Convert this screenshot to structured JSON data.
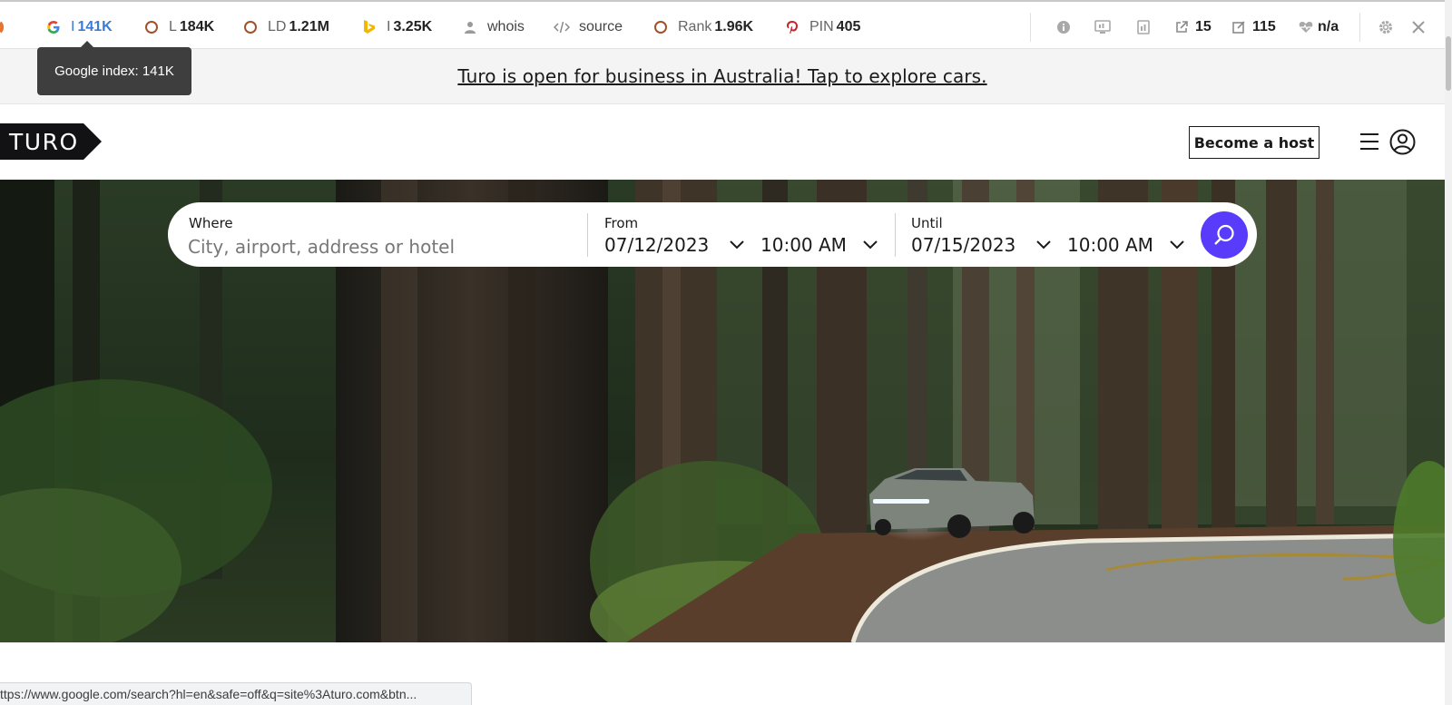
{
  "seo_toolbar": {
    "google": {
      "prefix": "I",
      "value": "141K"
    },
    "links": {
      "prefix": "L",
      "value": "184K"
    },
    "linking_domains": {
      "prefix": "LD",
      "value": "1.21M"
    },
    "bing": {
      "prefix": "I",
      "value": "3.25K"
    },
    "whois": "whois",
    "source": "source",
    "rank": {
      "prefix": "Rank",
      "value": "1.96K"
    },
    "pinterest": {
      "prefix": "PIN",
      "value": "405"
    },
    "external_links": "15",
    "internal_links": "115",
    "health": "n/a",
    "tooltip": "Google index: 141K"
  },
  "banner": {
    "text": "Turo is open for business in Australia! Tap to explore cars."
  },
  "header": {
    "logo_text": "TURO",
    "become_host_label": "Become a host"
  },
  "search": {
    "where_label": "Where",
    "where_placeholder": "City, airport, address or hotel",
    "from_label": "From",
    "from_date": "07/12/2023",
    "from_time": "10:00 AM",
    "until_label": "Until",
    "until_date": "07/15/2023",
    "until_time": "10:00 AM"
  },
  "colors": {
    "accent": "#593cfb",
    "banner_bg": "#f4f4f4",
    "tooltip_bg": "#3e3e3e"
  },
  "status_bar": {
    "url": "ttps://www.google.com/search?hl=en&safe=off&q=site%3Aturo.com&btn..."
  }
}
